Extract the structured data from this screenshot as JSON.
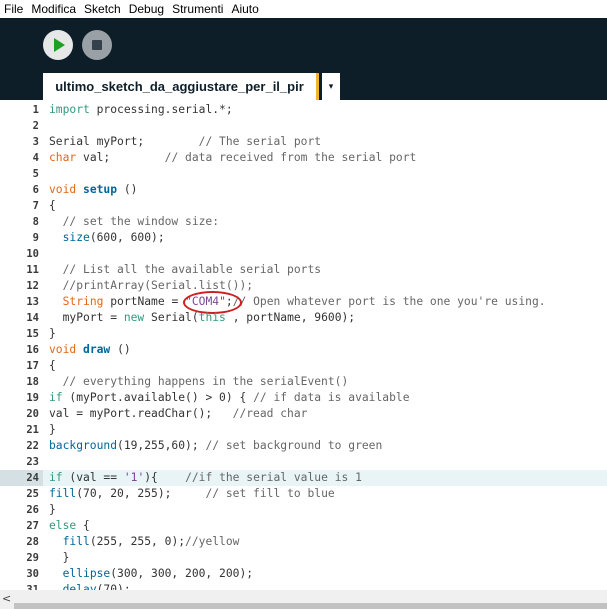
{
  "menu": [
    "File",
    "Modifica",
    "Sketch",
    "Debug",
    "Strumenti",
    "Aiuto"
  ],
  "toolbar": {
    "run_icon": "play-icon",
    "stop_icon": "stop-icon",
    "tab_label": "ultimo_sketch_da_aggiustare_per_il_pir",
    "tab_menu_icon": "▾",
    "accent_color": "#f0b431"
  },
  "editor": {
    "current_line": 24,
    "lines": [
      {
        "n": "1",
        "html": [
          [
            "kw",
            "import"
          ],
          [
            "",
            "processing.serial.*;"
          ]
        ]
      },
      {
        "n": "2",
        "html": []
      },
      {
        "n": "3",
        "html": [
          [
            "",
            "Serial myPort;        "
          ],
          [
            "cm",
            "// The serial port"
          ]
        ]
      },
      {
        "n": "4",
        "html": [
          [
            "ty",
            "char"
          ],
          [
            "",
            "val;        "
          ],
          [
            "cm",
            "// data received from the serial port"
          ]
        ]
      },
      {
        "n": "5",
        "html": []
      },
      {
        "n": "6",
        "html": [
          [
            "ty",
            "void"
          ],
          [
            "fnb",
            "setup"
          ],
          [
            "",
            "()"
          ]
        ]
      },
      {
        "n": "7",
        "html": [
          [
            "",
            "{"
          ]
        ]
      },
      {
        "n": "8",
        "html": [
          [
            "",
            "  "
          ],
          [
            "cm",
            "// set the window size:"
          ]
        ]
      },
      {
        "n": "9",
        "html": [
          [
            "",
            "  "
          ],
          [
            "fn",
            "size"
          ],
          [
            "",
            "(600, 600);"
          ]
        ]
      },
      {
        "n": "10",
        "html": []
      },
      {
        "n": "11",
        "html": [
          [
            "",
            "  "
          ],
          [
            "cm",
            "// List all the available serial ports"
          ]
        ]
      },
      {
        "n": "12",
        "html": [
          [
            "",
            "  "
          ],
          [
            "cm",
            "//printArray(Serial.list());"
          ]
        ]
      },
      {
        "n": "13",
        "html": [
          [
            "",
            "  "
          ],
          [
            "ty",
            "String"
          ],
          [
            "",
            "portName = "
          ],
          [
            "st",
            "\"COM4\""
          ],
          [
            "",
            ";"
          ],
          [
            "cm",
            "// Open whatever port is the one you're using."
          ]
        ]
      },
      {
        "n": "14",
        "html": [
          [
            "",
            "  myPort = "
          ],
          [
            "kw",
            "new"
          ],
          [
            "",
            "Serial("
          ],
          [
            "kw",
            "this"
          ],
          [
            "",
            ", portName, 9600);"
          ]
        ]
      },
      {
        "n": "15",
        "html": [
          [
            "",
            "}"
          ]
        ]
      },
      {
        "n": "16",
        "html": [
          [
            "ty",
            "void"
          ],
          [
            "fnb",
            "draw"
          ],
          [
            "",
            "()"
          ]
        ]
      },
      {
        "n": "17",
        "html": [
          [
            "",
            "{"
          ]
        ]
      },
      {
        "n": "18",
        "html": [
          [
            "",
            "  "
          ],
          [
            "cm",
            "// everything happens in the serialEvent()"
          ]
        ]
      },
      {
        "n": "19",
        "html": [
          [
            "kw",
            "if"
          ],
          [
            "",
            "(myPort.available() > 0) { "
          ],
          [
            "cm",
            "// if data is available"
          ]
        ]
      },
      {
        "n": "20",
        "html": [
          [
            "",
            "val = myPort.readChar();   "
          ],
          [
            "cm",
            "//read char"
          ]
        ]
      },
      {
        "n": "21",
        "html": [
          [
            "",
            "}"
          ]
        ]
      },
      {
        "n": "22",
        "html": [
          [
            "fn",
            "background"
          ],
          [
            "",
            "(19,255,60); "
          ],
          [
            "cm",
            "// set background to green"
          ]
        ]
      },
      {
        "n": "23",
        "html": []
      },
      {
        "n": "24",
        "html": [
          [
            "kw",
            "if"
          ],
          [
            "",
            "(val == "
          ],
          [
            "st",
            "'1'"
          ],
          [
            "",
            "){    "
          ],
          [
            "cm",
            "//if the serial value is 1"
          ]
        ]
      },
      {
        "n": "25",
        "html": [
          [
            "fn",
            "fill"
          ],
          [
            "",
            "(70, 20, 255);     "
          ],
          [
            "cm",
            "// set fill to blue"
          ]
        ]
      },
      {
        "n": "26",
        "html": [
          [
            "",
            "}"
          ]
        ]
      },
      {
        "n": "27",
        "html": [
          [
            "kw",
            "else"
          ],
          [
            "",
            "{"
          ]
        ]
      },
      {
        "n": "28",
        "html": [
          [
            "",
            "  "
          ],
          [
            "fn",
            "fill"
          ],
          [
            "",
            "(255, 255, 0);"
          ],
          [
            "cm",
            "//yellow"
          ]
        ]
      },
      {
        "n": "29",
        "html": [
          [
            "",
            "  }"
          ]
        ]
      },
      {
        "n": "30",
        "html": [
          [
            "",
            "  "
          ],
          [
            "fn",
            "ellipse"
          ],
          [
            "",
            "(300, 300, 200, 200);"
          ]
        ]
      },
      {
        "n": "31",
        "html": [
          [
            "",
            "  "
          ],
          [
            "fn",
            "delay"
          ],
          [
            "",
            "(70);"
          ]
        ]
      }
    ]
  },
  "annotation": {
    "color": "#cc1f1f",
    "target": "\"COM4\""
  },
  "scroll": {
    "left_arrow": "<"
  }
}
